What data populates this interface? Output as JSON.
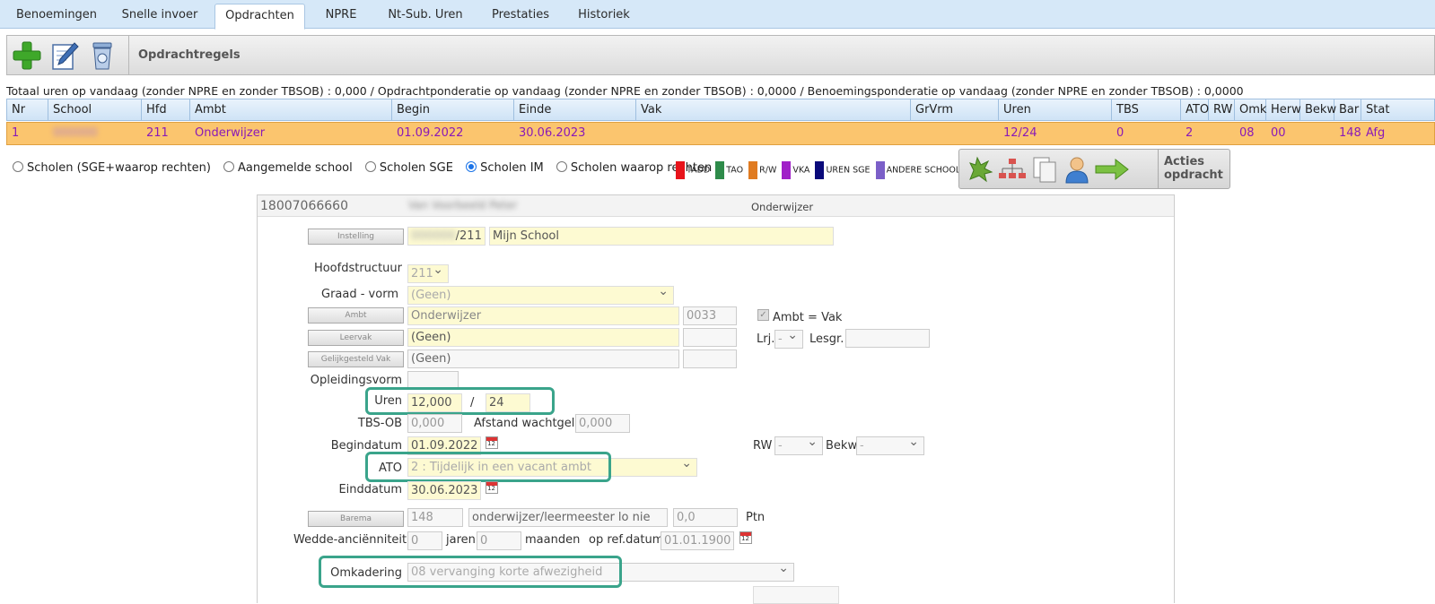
{
  "tabs": [
    {
      "label": "Benoemingen",
      "active": false
    },
    {
      "label": "Snelle invoer",
      "active": false
    },
    {
      "label": "Opdrachten",
      "active": true
    },
    {
      "label": "NPRE",
      "active": false
    },
    {
      "label": "Nt-Sub. Uren",
      "active": false
    },
    {
      "label": "Prestaties",
      "active": false
    },
    {
      "label": "Historiek",
      "active": false
    }
  ],
  "toolbar": {
    "title": "Opdrachtregels",
    "add_icon": "plus-icon",
    "edit_icon": "edit-icon",
    "delete_icon": "trash-icon"
  },
  "totals": "Totaal uren op vandaag (zonder NPRE en zonder TBSOB) : 0,000 / Opdrachtponderatie op vandaag (zonder NPRE en zonder TBSOB) : 0,0000 / Benoemingsponderatie op vandaag (zonder NPRE en zonder TBSOB) : 0,0000",
  "table": {
    "columns": [
      "Nr",
      "School",
      "Hfd",
      "Ambt",
      "Begin",
      "Einde",
      "Vak",
      "GrVrm",
      "Uren",
      "TBS",
      "ATO",
      "RW",
      "Omk",
      "Herw",
      "Bekw",
      "Bar",
      "Stat"
    ],
    "rows": [
      {
        "nr": "1",
        "school": "000000",
        "hfd": "211",
        "ambt": "Onderwijzer",
        "begin": "01.09.2022",
        "einde": "30.06.2023",
        "vak": "",
        "grvrm": "",
        "uren": "12/24",
        "tbs": "0",
        "ato": "2",
        "rw": "",
        "omk": "08",
        "herw": "00",
        "bekw": "",
        "bar": "148",
        "stat": "Afg"
      }
    ]
  },
  "radios": [
    {
      "label": "Scholen (SGE+waarop rechten)",
      "checked": false
    },
    {
      "label": "Aangemelde school",
      "checked": false
    },
    {
      "label": "Scholen SGE",
      "checked": false
    },
    {
      "label": "Scholen IM",
      "checked": true
    },
    {
      "label": "Scholen waarop rechten",
      "checked": false
    }
  ],
  "legend": [
    {
      "label": "TADD",
      "color": "#e8141b"
    },
    {
      "label": "TAO",
      "color": "#2e8b4a"
    },
    {
      "label": "R/W",
      "color": "#e07b21"
    },
    {
      "label": "VKA",
      "color": "#a020c8"
    },
    {
      "label": "UREN SGE",
      "color": "#0a0a7a"
    },
    {
      "label": "ANDERE SCHOOL",
      "color": "#7b5fc8"
    }
  ],
  "actions": {
    "label_line1": "Acties",
    "label_line2": "opdracht"
  },
  "form": {
    "header_number": "18007066660",
    "header_name": "Van Voorbeeld Peter",
    "header_ambt": "Onderwijzer",
    "instelling_btn": "Instelling",
    "instelling_code": "000000/211",
    "instelling_name": "Mijn School",
    "hoofdstructuur_label": "Hoofdstructuur",
    "hoofdstructuur_value": "211",
    "graad_label": "Graad - vorm",
    "graad_value": "(Geen)",
    "ambt_btn": "Ambt",
    "ambt_value": "Onderwijzer",
    "ambt_code": "0033",
    "ambt_vak_label": "Ambt = Vak",
    "leervak_btn": "Leervak",
    "leervak_value": "(Geen)",
    "lrj_label": "Lrj.",
    "lrj_value": "-",
    "lesgr_label": "Lesgr.",
    "gelijk_btn": "Gelijkgesteld Vak",
    "gelijk_value": "(Geen)",
    "opleiding_label": "Opleidingsvorm",
    "uren_label": "Uren",
    "uren_value": "12,000",
    "uren_sep": "/",
    "uren_total": "24",
    "tbsob_label": "TBS-OB",
    "tbsob_value": "0,000",
    "afstand_label": "Afstand wachtgeld",
    "afstand_value": "0,000",
    "begindatum_label": "Begindatum",
    "begindatum_value": "01.09.2022",
    "rw_label": "RW",
    "rw_value": "-",
    "bekw_label": "Bekw",
    "bekw_value": "-",
    "ato_label": "ATO",
    "ato_value": "2 : Tijdelijk in een vacant ambt",
    "einddatum_label": "Einddatum",
    "einddatum_value": "30.06.2023",
    "barema_btn": "Barema",
    "barema_code": "148",
    "barema_desc": "onderwijzer/leermeester lo nie",
    "barema_ptn": "0,0",
    "ptn_label": "Ptn",
    "wedde_label": "Wedde-anciënniteit",
    "wedde_jaren": "0",
    "jaren_label": "jaren",
    "wedde_maanden": "0",
    "maanden_label": "maanden",
    "refdatum_label": "op ref.datum",
    "refdatum_value": "01.01.1900",
    "omkadering_label": "Omkadering",
    "omkadering_value": "08 vervanging korte afwezigheid",
    "calendar_text": "12"
  }
}
